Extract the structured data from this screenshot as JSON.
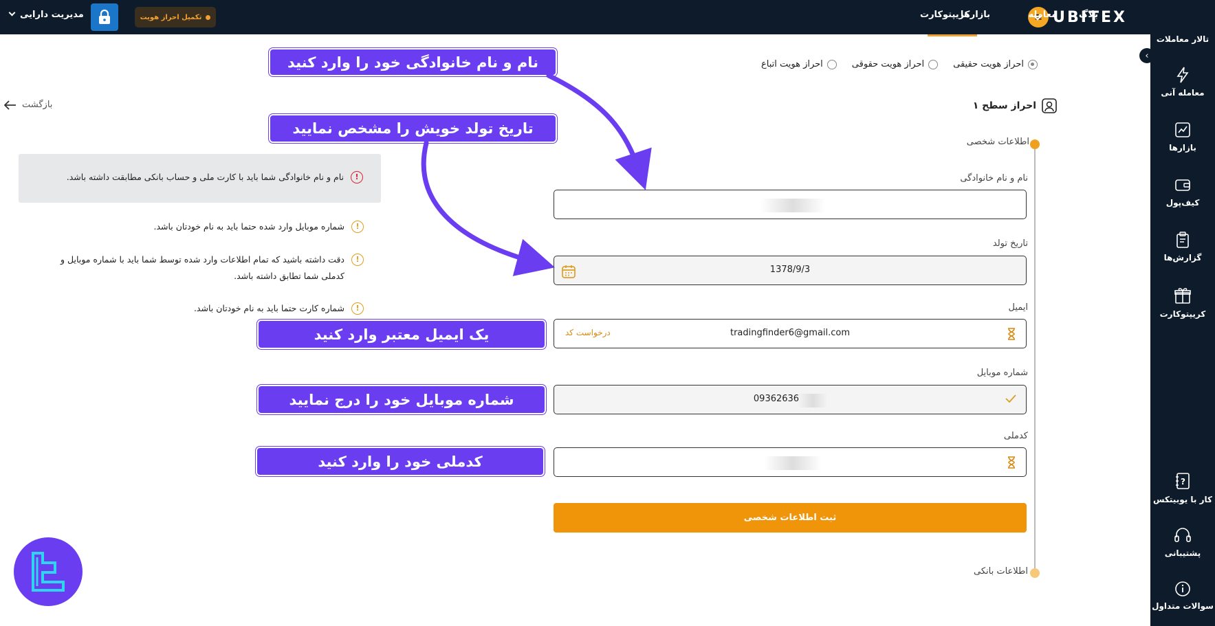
{
  "header": {
    "logo_text": "UBITEX",
    "nav": [
      "بازارها",
      "معامله",
      "بلاگ",
      "کریپتوکارت"
    ],
    "verify_badge": "تکمیل احراز هویت",
    "asset_menu": "مدیریت دارایی"
  },
  "sidebar": {
    "items": [
      {
        "label": "تالار معاملات",
        "icon": "trading-hall-icon"
      },
      {
        "label": "معامله آنی",
        "icon": "lightning-icon"
      },
      {
        "label": "بازارها",
        "icon": "chart-icon"
      },
      {
        "label": "کیف‌پول",
        "icon": "wallet-icon"
      },
      {
        "label": "گزارش‌ها",
        "icon": "clipboard-icon"
      },
      {
        "label": "کریپتوکارت",
        "icon": "gift-icon"
      },
      {
        "label": "کار با یوبیتکس",
        "icon": "help-book-icon"
      },
      {
        "label": "پشتیبانی",
        "icon": "headset-icon"
      },
      {
        "label": "سوالات متداول",
        "icon": "info-icon"
      }
    ]
  },
  "identity_types": [
    {
      "label": "احراز هویت حقیقی",
      "selected": true
    },
    {
      "label": "احراز هویت حقوقی",
      "selected": false
    },
    {
      "label": "احراز هویت اتباع",
      "selected": false
    }
  ],
  "back_label": "بازگشت",
  "level_title": "احراز سطح ۱",
  "sections": {
    "personal": "اطلاعات شخصی",
    "bank": "اطلاعات بانکی"
  },
  "form": {
    "name_label": "نام و نام خانوادگی",
    "birth_label": "تاریخ تولد",
    "birth_value": "1378/9/3",
    "email_label": "ایمیل",
    "email_value": "tradingfinder6@gmail.com",
    "email_request_code": "درخواست کد",
    "mobile_label": "شماره موبایل",
    "mobile_value": "09362636",
    "national_code_label": "کدملی",
    "submit": "ثبت اطلاعات شخصی"
  },
  "notices": {
    "box": "نام و نام خانوادگی شما باید با کارت ملی و حساب بانکی مطابقت داشته باشد.",
    "n1": "شماره موبایل وارد شده حتما باید به نام خودتان باشد.",
    "n2": "دقت داشته باشید که تمام اطلاعات وارد شده توسط شما باید با شماره موبایل و کدملی شما تطابق داشته باشد.",
    "n3": "شماره کارت حتما باید به نام خودتان باشد."
  },
  "annotations": {
    "a1": "نام و نام خانوادگی خود را وارد کنید",
    "a2": "تاریخ تولد خویش را مشخص نمایید",
    "a3": "یک ایمیل معتبر وارد کنید",
    "a4": "شماره موبایل خود را درج نمایید",
    "a5": "کدملی خود را وارد کنید"
  },
  "colors": {
    "navy": "#0d1b2a",
    "accent_orange": "#f0940a",
    "annotation_purple": "#6a3df0"
  }
}
